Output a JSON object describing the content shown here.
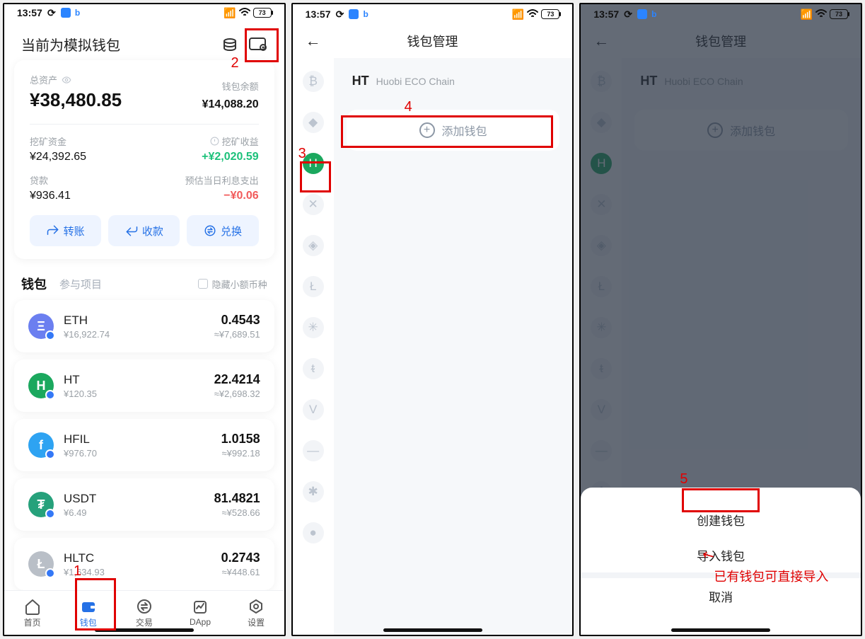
{
  "status": {
    "time": "13:57",
    "battery": "73"
  },
  "p1": {
    "title": "当前为模拟钱包",
    "annotations": {
      "n1": "1",
      "n2": "2"
    },
    "asset": {
      "total_label": "总资产",
      "total": "¥38,480.85",
      "balance_label": "钱包余额",
      "balance": "¥14,088.20",
      "mining_fund_label": "挖矿资金",
      "mining_fund": "¥24,392.65",
      "mining_yield_label": "挖矿收益",
      "mining_yield": "+¥2,020.59",
      "loan_label": "贷款",
      "loan": "¥936.41",
      "interest_label": "预估当日利息支出",
      "interest": "−¥0.06"
    },
    "actions": {
      "transfer": "转账",
      "receive": "收款",
      "swap": "兑换"
    },
    "wallet_tabs": {
      "wallet": "钱包",
      "projects": "参与项目",
      "hide_small": "隐藏小额币种"
    },
    "coins": [
      {
        "sym": "ETH",
        "price": "¥16,922.74",
        "amt": "0.4543",
        "fiat": "≈¥7,689.51",
        "bg": "#6b7ff0",
        "glyph": "Ξ"
      },
      {
        "sym": "HT",
        "price": "¥120.35",
        "amt": "22.4214",
        "fiat": "≈¥2,698.32",
        "bg": "#1ba85e",
        "glyph": "H"
      },
      {
        "sym": "HFIL",
        "price": "¥976.70",
        "amt": "1.0158",
        "fiat": "≈¥992.18",
        "bg": "#2ea3f2",
        "glyph": "f"
      },
      {
        "sym": "USDT",
        "price": "¥6.49",
        "amt": "81.4821",
        "fiat": "≈¥528.66",
        "bg": "#26a17b",
        "glyph": "₮"
      },
      {
        "sym": "HLTC",
        "price": "¥1,634.93",
        "amt": "0.2743",
        "fiat": "≈¥448.61",
        "bg": "#b9bfc7",
        "glyph": "Ł"
      }
    ],
    "tabs": {
      "home": "首页",
      "wallet": "钱包",
      "trade": "交易",
      "dapp": "DApp",
      "settings": "设置"
    }
  },
  "p2": {
    "title": "钱包管理",
    "annotations": {
      "n3": "3",
      "n4": "4"
    },
    "chain": {
      "sym": "HT",
      "name": "Huobi ECO Chain"
    },
    "add_wallet": "添加钱包",
    "rail": [
      "₿",
      "◆",
      "H",
      "✕",
      "◈",
      "Ł",
      "✳",
      "ᵵ",
      "V",
      "—",
      "✱",
      "●"
    ]
  },
  "p3": {
    "title": "钱包管理",
    "annotations": {
      "n5": "5",
      "arrow_note": "已有钱包可直接导入"
    },
    "chain": {
      "sym": "HT",
      "name": "Huobi ECO Chain"
    },
    "add_wallet": "添加钱包",
    "sheet": {
      "create": "创建钱包",
      "import": "导入钱包",
      "cancel": "取消"
    }
  }
}
